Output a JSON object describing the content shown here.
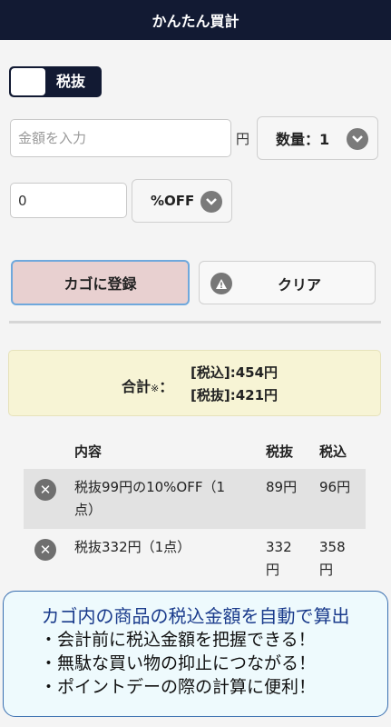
{
  "header": {
    "title": "かんたん買計"
  },
  "tax_toggle": {
    "label": "税抜"
  },
  "price_input": {
    "placeholder": "金額を入力",
    "unit": "円"
  },
  "quantity_select": {
    "label": "数量：1"
  },
  "discount_input": {
    "value": "0"
  },
  "discount_select": {
    "label": "%OFF"
  },
  "buttons": {
    "register": "カゴに登録",
    "clear": "クリア"
  },
  "total": {
    "label": "合計",
    "asterisk": "※",
    "colon": "：",
    "incl": "[税込]:454円",
    "excl": "[税抜]:421円"
  },
  "table": {
    "headers": {
      "content": "内容",
      "excl": "税抜",
      "incl": "税込"
    },
    "rows": [
      {
        "content_line1": "税抜99円の10%OFF（1",
        "content_line2": "点）",
        "excl": "89円",
        "excl_line2": "",
        "incl": "96円",
        "incl_line2": ""
      },
      {
        "content_line1": "税抜332円（1点）",
        "content_line2": "",
        "excl": "332",
        "excl_line2": "円",
        "incl": "358",
        "incl_line2": "円"
      }
    ]
  },
  "promo": {
    "title": "カゴ内の商品の税込金額を自動で算出",
    "points": [
      "・会計前に税込金額を把握できる！",
      "・無駄な買い物の抑止につながる！",
      "・ポイントデーの際の計算に便利！"
    ]
  },
  "icons": {
    "chevron": "chevron-down-icon",
    "warning": "warning-icon",
    "remove": "close-circle-icon"
  },
  "colors": {
    "navy": "#121a33",
    "register_bg": "#e8d0d0",
    "register_border": "#6fa8dc",
    "total_bg": "#f7f4d5",
    "promo_border": "#3a6fb0",
    "promo_title": "#1a3b8c"
  }
}
